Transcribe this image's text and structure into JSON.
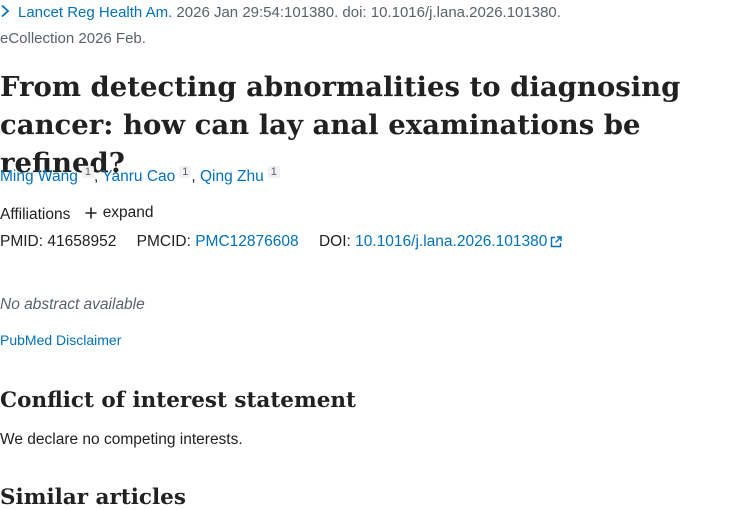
{
  "citation": {
    "journal": "Lancet Reg Health Am.",
    "details": " 2026 Jan 29:54:101380. doi: 10.1016/j.lana.2026.101380.",
    "ecollection": "eCollection 2026 Feb."
  },
  "article": {
    "title": "From detecting abnormalities to diagnosing cancer: how can lay anal examinations be refined?"
  },
  "authors": [
    {
      "name": "Ming Wang",
      "affiliation": "1"
    },
    {
      "name": "Yanru Cao",
      "affiliation": "1"
    },
    {
      "name": "Qing Zhu",
      "affiliation": "1"
    }
  ],
  "affiliations": {
    "label": "Affiliations",
    "expand_label": "expand"
  },
  "identifiers": {
    "pmid_label": "PMID:",
    "pmid": "41658952",
    "pmcid_label": "PMCID:",
    "pmcid": "PMC12876608",
    "doi_label": "DOI:",
    "doi": "10.1016/j.lana.2026.101380"
  },
  "abstract": {
    "status": "No abstract available"
  },
  "disclaimer_link": "PubMed Disclaimer",
  "conflict": {
    "heading": "Conflict of interest statement",
    "text": "We declare no competing interests."
  },
  "similar": {
    "heading": "Similar articles"
  },
  "icons": {
    "journal_chevron": "chevron-right-icon",
    "expand": "plus-icon",
    "external_link": "external-link-icon"
  },
  "colors": {
    "link": "#0071bc",
    "text": "#212121",
    "muted": "#5b616b"
  }
}
